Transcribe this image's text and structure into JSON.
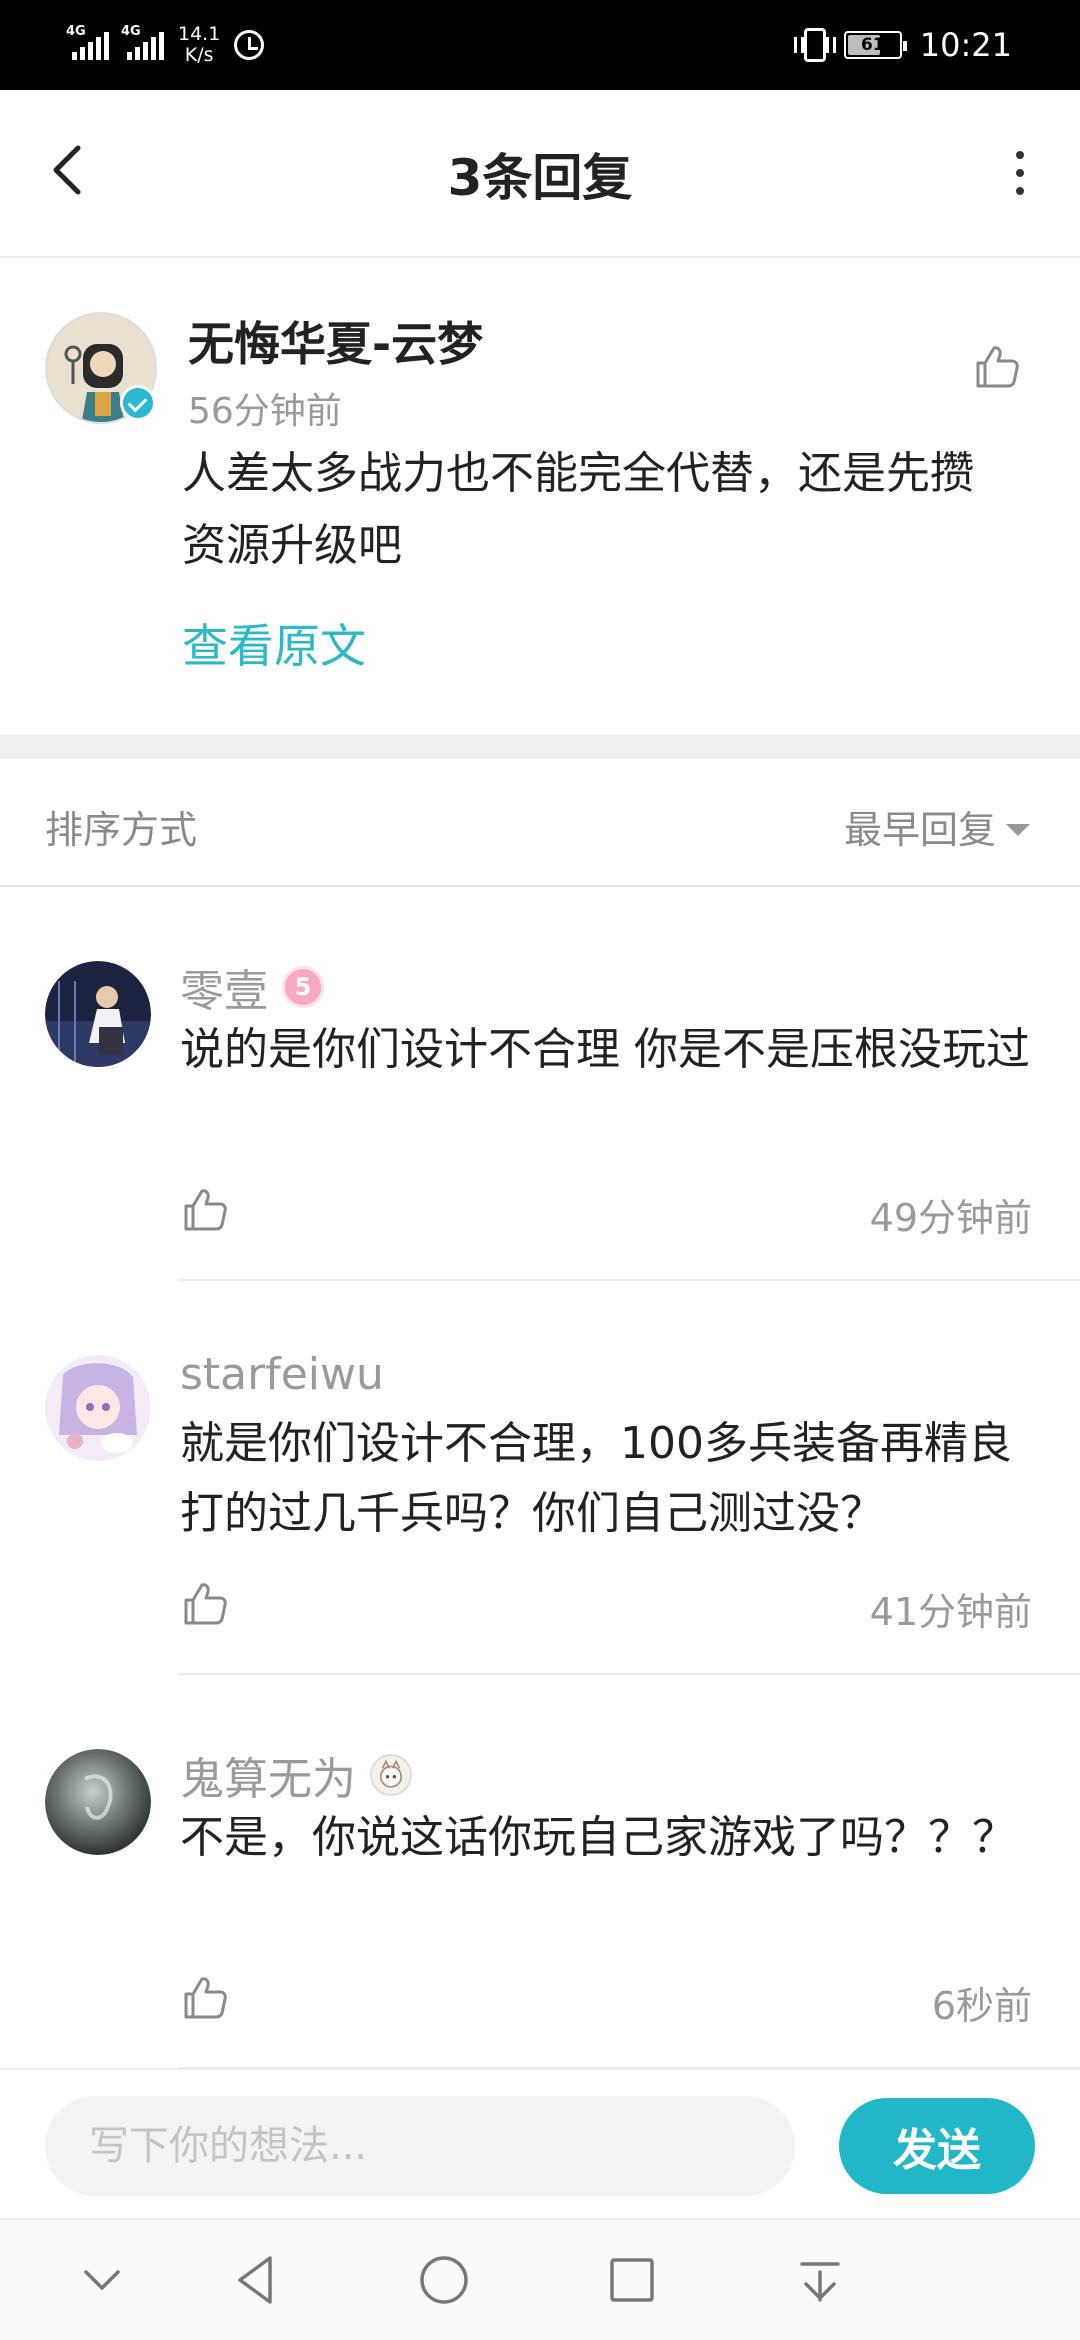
{
  "status_bar": {
    "network_1": "4G",
    "network_2": "4G",
    "speed_value": "14.1",
    "speed_unit": "K/s",
    "battery": "61",
    "time": "10:21"
  },
  "header": {
    "title": "3条回复"
  },
  "main_comment": {
    "author": "无悔华夏-云梦",
    "time": "56分钟前",
    "text": "人差太多战力也不能完全代替，还是先攒资源升级吧",
    "view_original": "查看原文"
  },
  "sort": {
    "label": "排序方式",
    "selected": "最早回复"
  },
  "replies": [
    {
      "author": "零壹",
      "badge": "5",
      "text": "说的是你们设计不合理 你是不是压根没玩过",
      "time": "49分钟前"
    },
    {
      "author": "starfeiwu",
      "text": "就是你们设计不合理，100多兵装备再精良打的过几千兵吗？你们自己测过没？",
      "time": "41分钟前"
    },
    {
      "author": "鬼算无为",
      "text": "不是，你说这话你玩自己家游戏了吗？？？",
      "time": "6秒前"
    }
  ],
  "input": {
    "placeholder": "写下你的想法...",
    "send_label": "发送"
  },
  "colors": {
    "accent": "#21b7c6",
    "link": "#2bb9c6",
    "muted_text": "#9a9a9a"
  },
  "icons": [
    "back-arrow-icon",
    "more-vertical-icon",
    "thumbs-up-icon",
    "verified-check-icon",
    "dropdown-caret-icon",
    "collapse-chevron-icon",
    "nav-back-triangle-icon",
    "nav-home-circle-icon",
    "nav-recents-square-icon",
    "nav-download-icon"
  ]
}
